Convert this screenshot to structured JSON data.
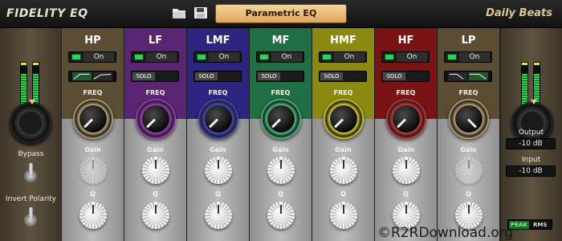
{
  "header": {
    "brand": "FIDELITY EQ",
    "product": "Daily Beats",
    "preset": "Parametric EQ"
  },
  "left_panel": {
    "bypass_label": "Bypass",
    "invert_label": "Invert Polarity"
  },
  "right_panel": {
    "output_label": "Output",
    "output_value": "-10 dB",
    "input_label": "Input",
    "input_value": "-10 dB",
    "peak_label": "PEAK",
    "rms_label": "RMS"
  },
  "bands": [
    {
      "name": "HP",
      "on": "On",
      "freq": "FREQ",
      "gain": "Gain",
      "q": "Q",
      "color": "#5a4d33",
      "knob": "#cfb37a"
    },
    {
      "name": "LF",
      "on": "On",
      "solo": "SOLO",
      "freq": "FREQ",
      "gain": "Gain",
      "q": "Q",
      "color": "#5a2572",
      "knob": "#b43bd4"
    },
    {
      "name": "LMF",
      "on": "On",
      "solo": "SOLO",
      "freq": "FREQ",
      "gain": "Gain",
      "q": "Q",
      "color": "#2d2580",
      "knob": "#4a4ad8"
    },
    {
      "name": "MF",
      "on": "On",
      "solo": "SOLO",
      "freq": "FREQ",
      "gain": "Gain",
      "q": "Q",
      "color": "#1f6e44",
      "knob": "#48d48c"
    },
    {
      "name": "HMF",
      "on": "On",
      "solo": "SOLO",
      "freq": "FREQ",
      "gain": "Gain",
      "q": "Q",
      "color": "#8a8a12",
      "knob": "#eae426"
    },
    {
      "name": "HF",
      "on": "On",
      "solo": "SOLO",
      "freq": "FREQ",
      "gain": "Gain",
      "q": "Q",
      "color": "#7a1414",
      "knob": "#e23434"
    },
    {
      "name": "LP",
      "on": "On",
      "freq": "FREQ",
      "gain": "Gain",
      "q": "Q",
      "color": "#5a4d33",
      "knob": "#cfb37a"
    }
  ],
  "watermark": "©R2RDownload.org",
  "colors": {
    "accent": "#e0a55a",
    "led": "#2fcf5a"
  }
}
